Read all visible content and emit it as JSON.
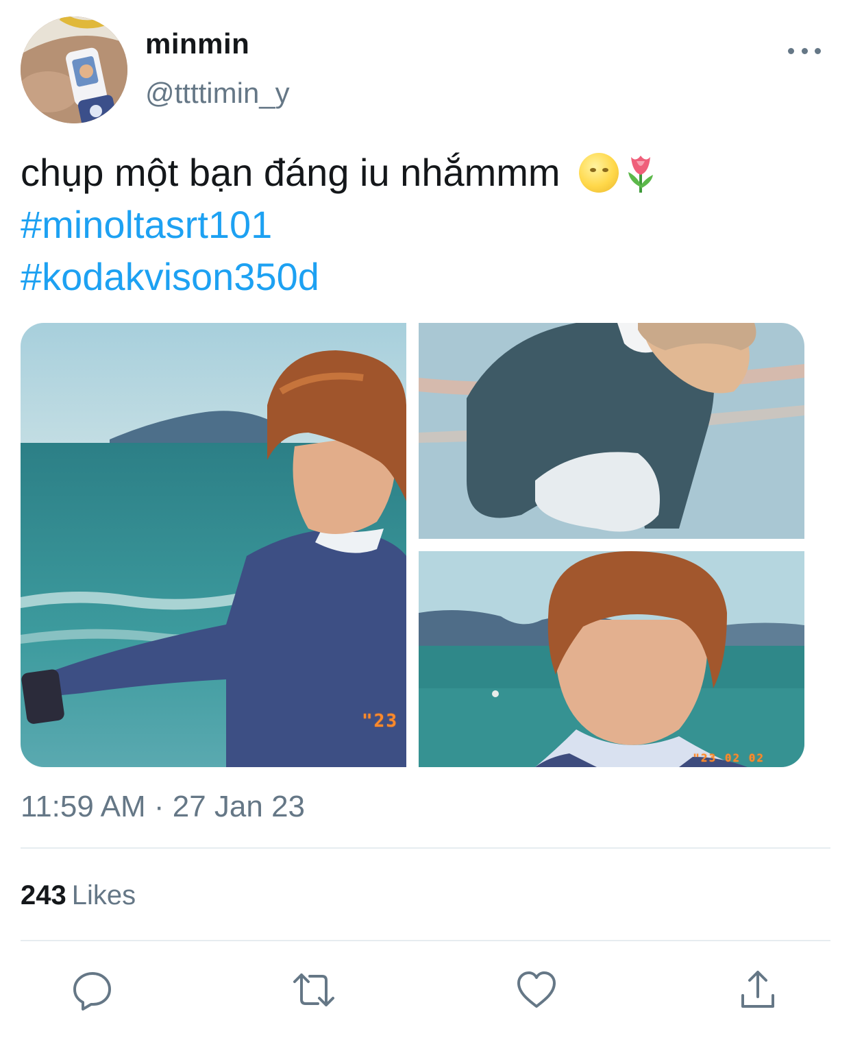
{
  "author": {
    "display_name": "minmin",
    "handle": "@ttttimin_y",
    "avatar_icon": "avatar-photo"
  },
  "tweet": {
    "text": "chụp một bạn đáng iu nhắmmm",
    "emojis": [
      "full-moon-face-emoji",
      "tulip-emoji"
    ],
    "hashtags": [
      "#minoltasrt101",
      "#kodakvison350d"
    ]
  },
  "media": {
    "photos": [
      {
        "name": "photo-beach-portrait",
        "stamp": "\"23"
      },
      {
        "name": "photo-crouching-sweater",
        "stamp": ""
      },
      {
        "name": "photo-closeup-sea",
        "stamp": "\"23 02 02"
      }
    ]
  },
  "timestamp": "11:59 AM · 27 Jan 23",
  "stats": {
    "likes_count": "243",
    "likes_label": "Likes"
  },
  "actions": {
    "reply_icon": "reply-icon",
    "retweet_icon": "retweet-icon",
    "like_icon": "heart-icon",
    "share_icon": "share-icon"
  },
  "colors": {
    "text": "#14171a",
    "secondary": "#657786",
    "link": "#1da1f2",
    "divider": "#e6ecf0",
    "date_stamp": "#ff8a2a"
  }
}
